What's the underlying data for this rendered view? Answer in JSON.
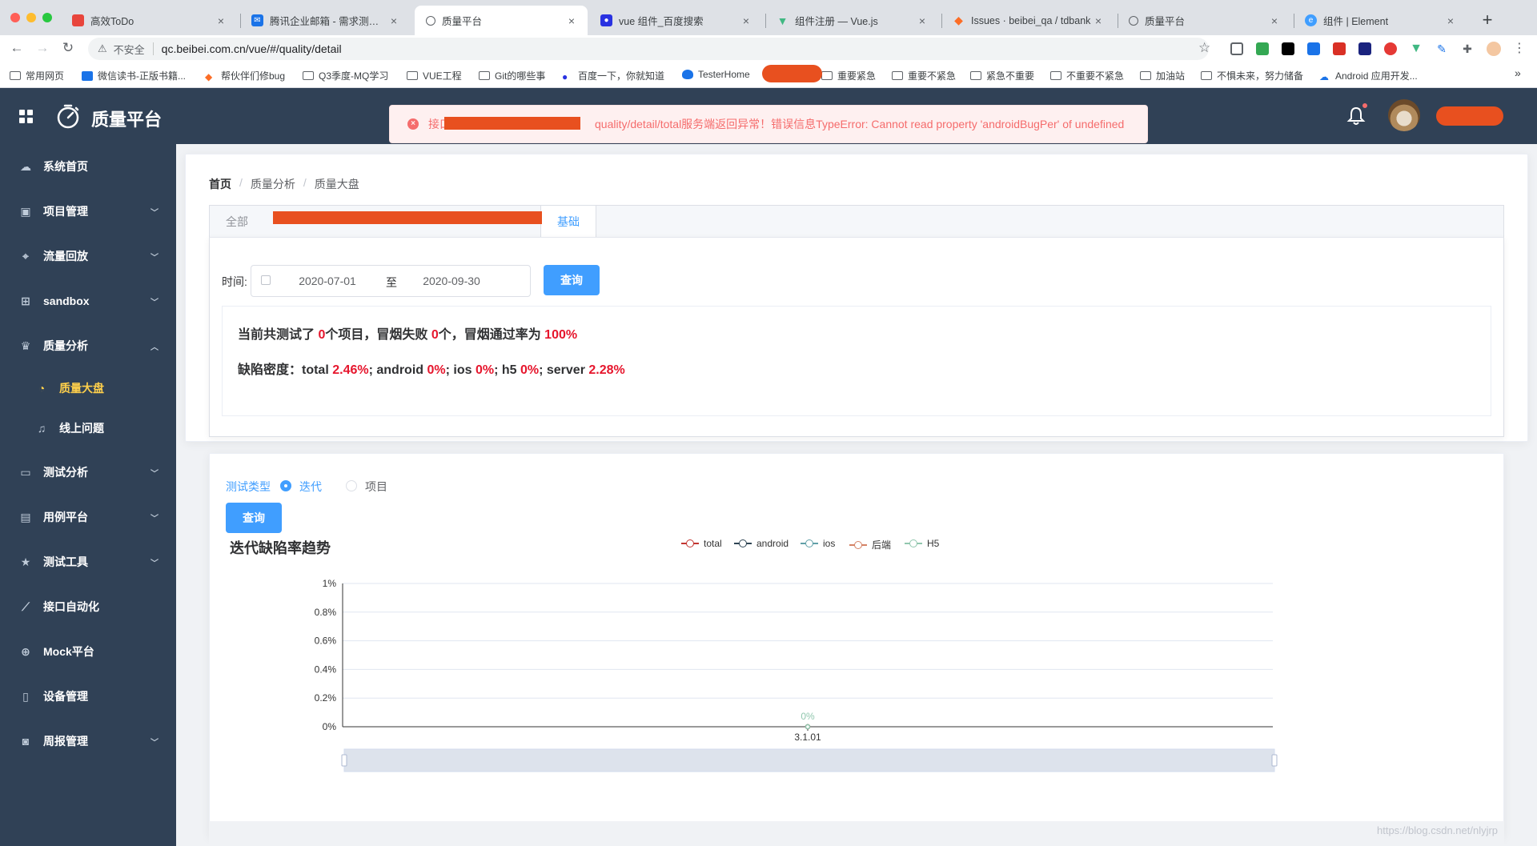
{
  "browser": {
    "tabs": [
      {
        "title": "高效ToDo",
        "icon_color": "#e8453c"
      },
      {
        "title": "腾讯企业邮箱 - 需求测试平台",
        "icon_color": "#1a73e8"
      },
      {
        "title": "质量平台",
        "icon_color": "#5f6368"
      },
      {
        "title": "vue 组件_百度搜索",
        "icon_color": "#2932e1"
      },
      {
        "title": "组件注册 — Vue.js",
        "icon_color": "#41b883"
      },
      {
        "title": "Issues · beibei_qa / tdbank",
        "icon_color": "#fc6d26"
      },
      {
        "title": "质量平台",
        "icon_color": "#5f6368"
      },
      {
        "title": "组件 | Element",
        "icon_color": "#409eff"
      }
    ],
    "close_glyph": "×",
    "new_tab_glyph": "+",
    "nav": {
      "back": "←",
      "forward": "→",
      "reload": "↻"
    },
    "address": {
      "security_label": "不安全",
      "url": "qc.beibei.com.cn/vue/#/quality/detail"
    },
    "star_glyph": "☆",
    "bookmarks": [
      {
        "label": "常用网页",
        "icon": "folder-icon"
      },
      {
        "label": "微信读书-正版书籍...",
        "icon": "wechat-read-icon"
      },
      {
        "label": "帮伙伴们修bug",
        "icon": "gitlab-icon"
      },
      {
        "label": "Q3季度-MQ学习",
        "icon": "folder-icon"
      },
      {
        "label": "VUE工程",
        "icon": "folder-icon"
      },
      {
        "label": "Git的哪些事",
        "icon": "folder-icon"
      },
      {
        "label": "百度一下，你就知道",
        "icon": "baidu-icon"
      },
      {
        "label": "TesterHome",
        "icon": "testerhome-icon"
      },
      {
        "label": "重要紧急",
        "icon": "folder-icon"
      },
      {
        "label": "重要不紧急",
        "icon": "folder-icon"
      },
      {
        "label": "紧急不重要",
        "icon": "folder-icon"
      },
      {
        "label": "不重要不紧急",
        "icon": "folder-icon"
      },
      {
        "label": "加油站",
        "icon": "folder-icon"
      },
      {
        "label": "不惧未来，努力储备",
        "icon": "folder-icon"
      },
      {
        "label": "Android 应用开发...",
        "icon": "cloud-icon"
      }
    ],
    "more_bookmarks_glyph": "»"
  },
  "app": {
    "title": "质量平台",
    "toast": {
      "prefix": "接口",
      "message": "quality/detail/total服务端返回异常！错误信息TypeError: Cannot read property 'androidBugPer' of undefined",
      "icon_glyph": "×",
      "color": "#f56c6c"
    }
  },
  "sidebar": {
    "items": [
      {
        "label": "系统首页",
        "icon": "cloud-icon",
        "chevron": ""
      },
      {
        "label": "项目管理",
        "icon": "clipboard-icon",
        "chevron": "﹀"
      },
      {
        "label": "流量回放",
        "icon": "location-icon",
        "chevron": "﹀"
      },
      {
        "label": "sandbox",
        "icon": "box-icon",
        "chevron": "﹀"
      },
      {
        "label": "质量分析",
        "icon": "trophy-icon",
        "chevron": "︿"
      },
      {
        "label": "质量大盘",
        "icon": "pie-chart-icon",
        "chevron": ""
      },
      {
        "label": "线上问题",
        "icon": "bell-icon",
        "chevron": ""
      },
      {
        "label": "测试分析",
        "icon": "monitor-icon",
        "chevron": "﹀"
      },
      {
        "label": "用例平台",
        "icon": "printer-icon",
        "chevron": "﹀"
      },
      {
        "label": "测试工具",
        "icon": "star-icon",
        "chevron": "﹀"
      },
      {
        "label": "接口自动化",
        "icon": "chart-line-icon",
        "chevron": ""
      },
      {
        "label": "Mock平台",
        "icon": "plus-circle-icon",
        "chevron": ""
      },
      {
        "label": "设备管理",
        "icon": "mobile-icon",
        "chevron": ""
      },
      {
        "label": "周报管理",
        "icon": "camera-icon",
        "chevron": "﹀"
      }
    ],
    "active_color": "#ffd04b"
  },
  "breadcrumb": [
    "首页",
    "质量分析",
    "质量大盘"
  ],
  "breadcrumb_sep": "/",
  "tabs": [
    {
      "label": "全部"
    },
    {
      "label": "基础"
    }
  ],
  "filter": {
    "time_label": "时间:",
    "start_date": "2020-07-01",
    "range_sep": "至",
    "end_date": "2020-09-30",
    "query_label": "查询"
  },
  "summary": {
    "line1": {
      "a": "当前共测试了 ",
      "projects": "0",
      "b": "个项目，冒烟失败 ",
      "failed": "0",
      "c": "个，冒烟通过率为 ",
      "rate": "100%"
    },
    "line2": {
      "a": "缺陷密度：total ",
      "total": "2.46%",
      "b": "; android ",
      "android": "0%",
      "c": "; ios ",
      "ios": "0%",
      "d": "; h5 ",
      "h5": "0%",
      "e": "; server ",
      "server": "2.28%"
    }
  },
  "trend": {
    "type_label": "测试类型",
    "options": [
      "迭代",
      "项目"
    ],
    "selected": "迭代",
    "query_label": "查询"
  },
  "chart_data": {
    "type": "line",
    "title": "迭代缺陷率趋势",
    "categories": [
      "3.1.01"
    ],
    "series": [
      {
        "name": "total",
        "values": [
          0
        ],
        "color": "#c23531"
      },
      {
        "name": "android",
        "values": [
          0
        ],
        "color": "#2f4554"
      },
      {
        "name": "ios",
        "values": [
          0
        ],
        "color": "#61a0a8"
      },
      {
        "name": "后端",
        "values": [
          0
        ],
        "color": "#d48265"
      },
      {
        "name": "H5",
        "values": [
          0
        ],
        "color": "#91c7ae"
      }
    ],
    "yticks": [
      "0%",
      "0.2%",
      "0.4%",
      "0.6%",
      "0.8%",
      "1%"
    ],
    "ylim": [
      0,
      1
    ],
    "y_unit": "%",
    "data_label": "0%",
    "legend_position": "top-center",
    "grid": true,
    "datazoom": true
  },
  "watermark": "https://blog.csdn.net/nlyjrp"
}
